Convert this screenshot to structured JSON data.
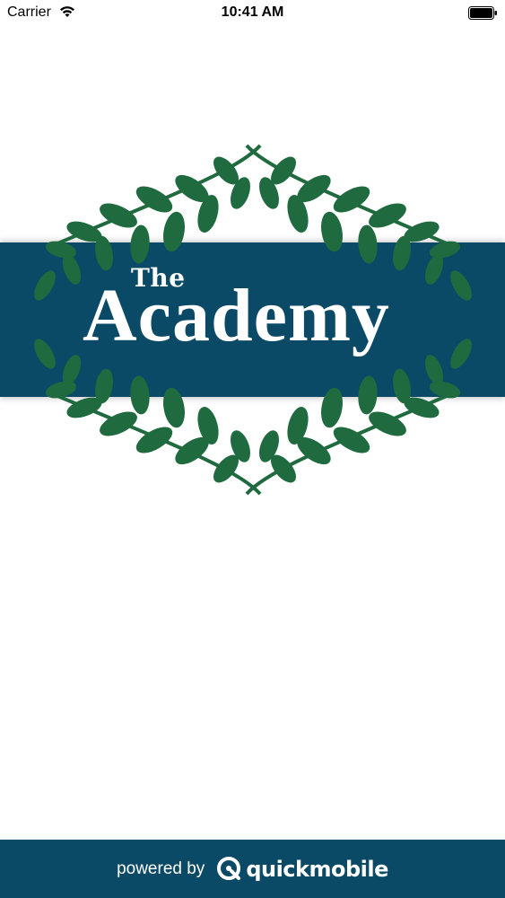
{
  "status_bar": {
    "carrier": "Carrier",
    "time": "10:41 AM",
    "wifi_icon": "wifi-icon",
    "battery_icon": "battery-icon"
  },
  "logo": {
    "the": "The",
    "academy": "Academy",
    "banner_color": "#0b4a66",
    "leaf_color": "#1f6b3f"
  },
  "footer": {
    "powered_by": "powered by",
    "brand": "quickmobile",
    "brand_icon": "quickmobile-logo-icon",
    "background": "#0b4a66"
  }
}
